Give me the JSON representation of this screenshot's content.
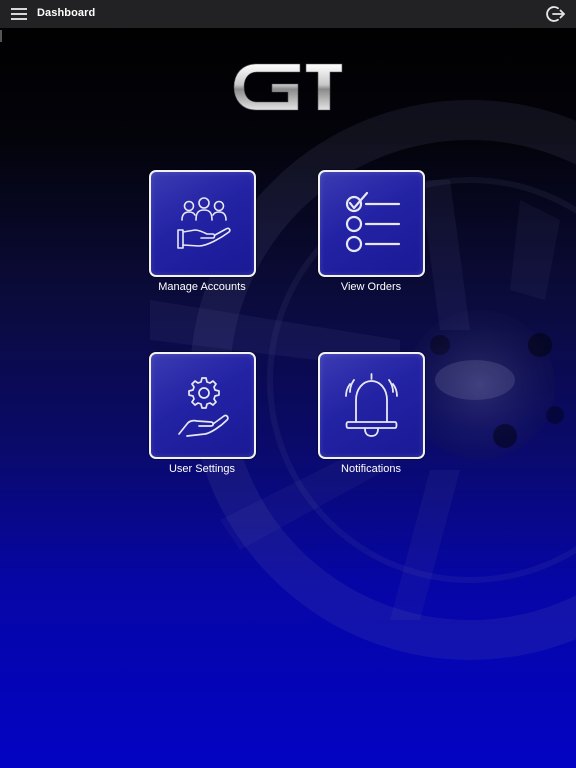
{
  "header": {
    "title": "Dashboard",
    "menu_icon": "hamburger-menu-icon",
    "logout_icon": "logout-icon"
  },
  "logo": {
    "icon": "gi-logo"
  },
  "tiles": [
    {
      "label": "Manage Accounts",
      "icon": "group-hand-icon"
    },
    {
      "label": "View Orders",
      "icon": "checklist-icon"
    },
    {
      "label": "User Settings",
      "icon": "gear-hand-icon"
    },
    {
      "label": "Notifications",
      "icon": "bell-icon"
    }
  ],
  "colors": {
    "topbar": "#222224",
    "tile_fill": "#2222a4",
    "tile_border": "#f2f2f2",
    "background_bottom": "#0303c4"
  }
}
